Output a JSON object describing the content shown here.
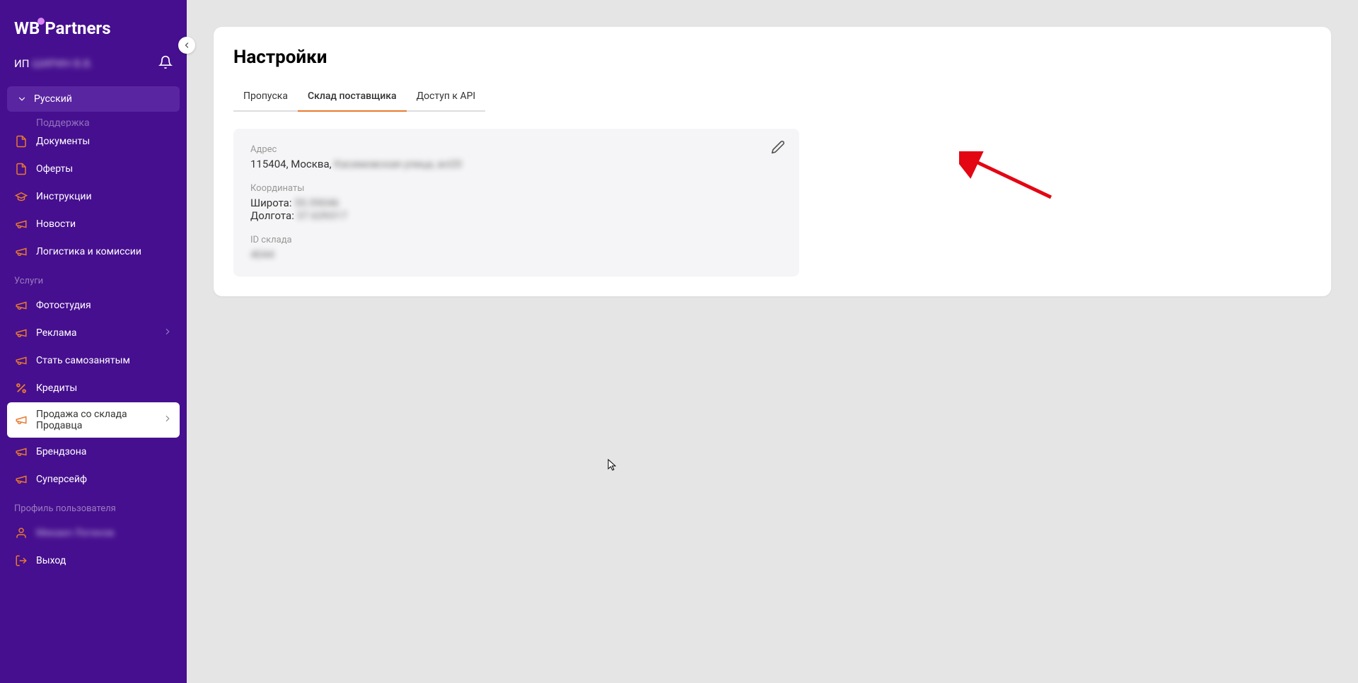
{
  "logo": {
    "wb": "WB",
    "partners": "Partners"
  },
  "user": {
    "prefix": "ИП",
    "name_blurred": "ШИРИН В.В."
  },
  "language": "Русский",
  "nav": {
    "top_cut": "Поддержка",
    "items": [
      {
        "icon": "document-icon",
        "label": "Документы"
      },
      {
        "icon": "document-icon",
        "label": "Оферты"
      },
      {
        "icon": "grad-icon",
        "label": "Инструкции"
      },
      {
        "icon": "megaphone-icon",
        "label": "Новости"
      },
      {
        "icon": "megaphone-icon",
        "label": "Логистика и комиссии"
      }
    ],
    "services_header": "Услуги",
    "services": [
      {
        "icon": "megaphone-icon",
        "label": "Фотостудия",
        "chevron": false
      },
      {
        "icon": "megaphone-icon",
        "label": "Реклама",
        "chevron": true
      },
      {
        "icon": "megaphone-icon",
        "label": "Стать самозанятым",
        "chevron": false
      },
      {
        "icon": "percent-icon",
        "label": "Кредиты",
        "chevron": false
      },
      {
        "icon": "megaphone-icon",
        "label": "Продажа со склада Продавца",
        "chevron": true,
        "active": true
      },
      {
        "icon": "megaphone-icon",
        "label": "Брендзона",
        "chevron": false
      },
      {
        "icon": "megaphone-icon",
        "label": "Суперсейф",
        "chevron": false
      }
    ],
    "profile_header": "Профиль пользователя",
    "profile": [
      {
        "icon": "person-icon",
        "label_blurred": "Михаил Логинов"
      },
      {
        "icon": "logout-icon",
        "label": "Выход"
      }
    ]
  },
  "page": {
    "title": "Настройки",
    "tabs": [
      {
        "label": "Пропуска",
        "active": false
      },
      {
        "label": "Склад поставщика",
        "active": true
      },
      {
        "label": "Доступ к API",
        "active": false
      }
    ]
  },
  "info": {
    "address_label": "Адрес",
    "address_visible": "115404, Москва, ",
    "address_blurred": "Касимовская улица, вл20",
    "coords_label": "Координаты",
    "lat_label": "Широта: ",
    "lat_value": "55.59046",
    "lon_label": "Долгота: ",
    "lon_value": "37.639317",
    "id_label": "ID склада",
    "id_value": "4044"
  }
}
